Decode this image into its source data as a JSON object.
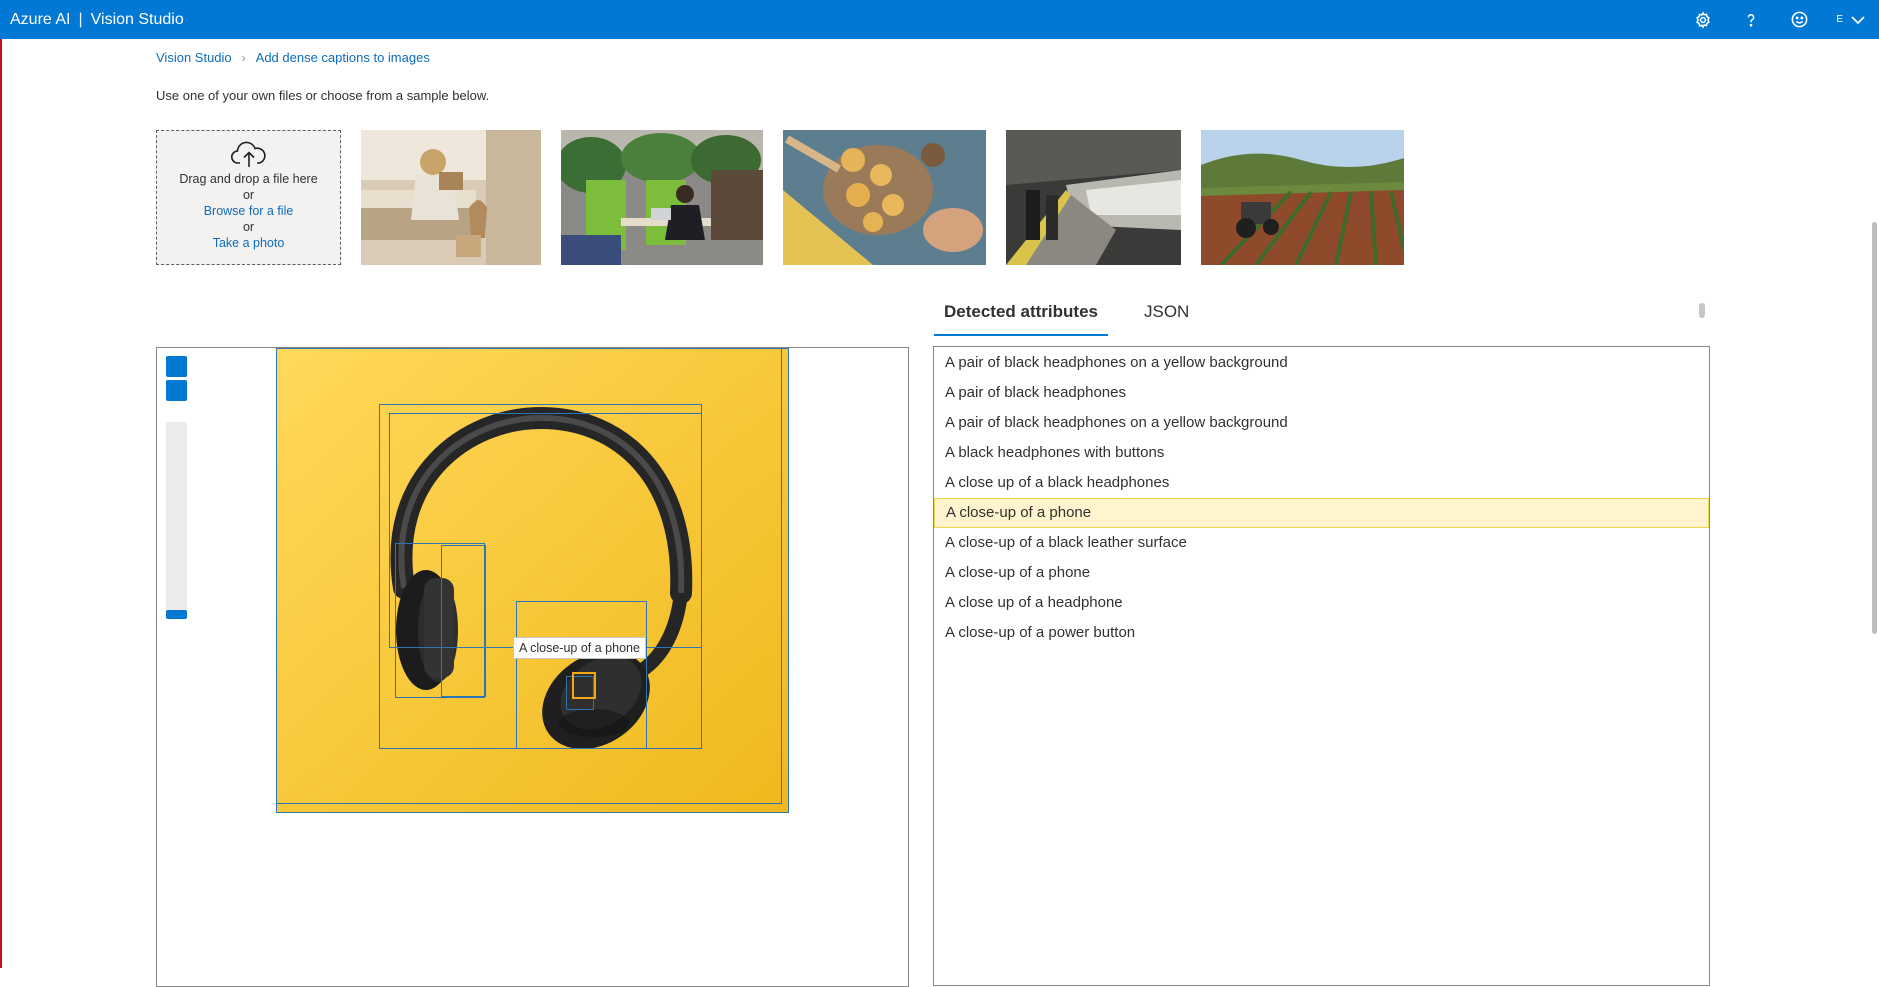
{
  "app": {
    "brand": "Azure AI",
    "separator": "|",
    "product": "Vision Studio",
    "account_initial": "E"
  },
  "icons": {
    "settings": "gear-icon",
    "help": "help-icon",
    "feedback": "smiley-icon",
    "account_menu": "chevron-down-icon",
    "upload": "cloud-upload-icon"
  },
  "breadcrumb": {
    "home": "Vision Studio",
    "current": "Add dense captions to images"
  },
  "instructions": "Use one of your own files or choose from a sample below.",
  "upload": {
    "drag_text": "Drag and drop a file here",
    "or1": "or",
    "browse": "Browse for a file",
    "or2": "or",
    "photo": "Take a photo"
  },
  "tabs": {
    "attributes": "Detected attributes",
    "json": "JSON"
  },
  "tooltip": "A close-up of a phone",
  "captions": [
    "A pair of black headphones on a yellow background",
    "A pair of black headphones",
    "A pair of black headphones on a yellow background",
    "A black headphones with buttons",
    "A close up of a black headphones",
    "A close-up of a phone",
    "A close-up of a black leather surface",
    "A close-up of a phone",
    "A close up of a headphone",
    "A close-up of a power button"
  ],
  "selected_index": 5,
  "colors": {
    "accent": "#0078d4",
    "highlight": "#fff4ce",
    "box": "#2e75b6",
    "box_highlight": "#f3a712",
    "image_bg": "#f7c81e"
  }
}
